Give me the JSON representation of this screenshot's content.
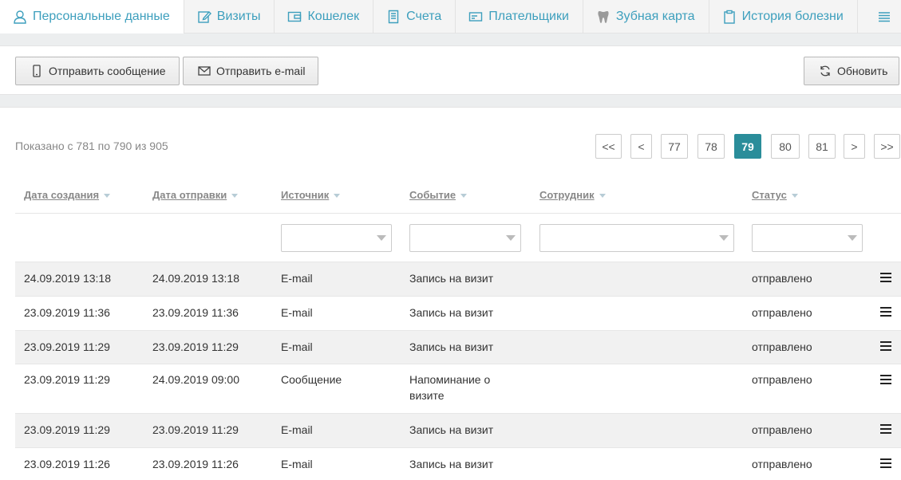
{
  "tabs": [
    {
      "label": "Персональные данные",
      "icon": "person-icon",
      "active": true
    },
    {
      "label": "Визиты",
      "icon": "edit-icon"
    },
    {
      "label": "Кошелек",
      "icon": "wallet-icon"
    },
    {
      "label": "Счета",
      "icon": "receipt-icon"
    },
    {
      "label": "Плательщики",
      "icon": "card-icon"
    },
    {
      "label": "Зубная карта",
      "icon": "tooth-icon"
    },
    {
      "label": "История болезни",
      "icon": "clipboard-icon"
    }
  ],
  "toolbar": {
    "send_message": "Отправить сообщение",
    "send_email": "Отправить e-mail",
    "refresh": "Обновить"
  },
  "summary": "Показано с 781 по 790 из 905",
  "pagination": {
    "first": "<<",
    "prev": "<",
    "pages": [
      "77",
      "78",
      "79",
      "80",
      "81"
    ],
    "current": "79",
    "next": ">",
    "last": ">>"
  },
  "columns": {
    "created": "Дата создания",
    "sent": "Дата отправки",
    "source": "Источник",
    "event": "Событие",
    "employee": "Сотрудник",
    "status": "Статус"
  },
  "rows": [
    {
      "created": "24.09.2019 13:18",
      "sent": "24.09.2019 13:18",
      "source": "E-mail",
      "event": "Запись на визит",
      "employee": "",
      "status": "отправлено"
    },
    {
      "created": "23.09.2019 11:36",
      "sent": "23.09.2019 11:36",
      "source": "E-mail",
      "event": "Запись на визит",
      "employee": "",
      "status": "отправлено"
    },
    {
      "created": "23.09.2019 11:29",
      "sent": "23.09.2019 11:29",
      "source": "E-mail",
      "event": "Запись на визит",
      "employee": "",
      "status": "отправлено"
    },
    {
      "created": "23.09.2019 11:29",
      "sent": "24.09.2019 09:00",
      "source": "Сообщение",
      "event": "Напоминание о визите",
      "employee": "",
      "status": "отправлено"
    },
    {
      "created": "23.09.2019 11:29",
      "sent": "23.09.2019 11:29",
      "source": "E-mail",
      "event": "Запись на визит",
      "employee": "",
      "status": "отправлено"
    },
    {
      "created": "23.09.2019 11:26",
      "sent": "23.09.2019 11:26",
      "source": "E-mail",
      "event": "Запись на визит",
      "employee": "",
      "status": "отправлено"
    }
  ],
  "colors": {
    "accent": "#3d9fbd",
    "active_page": "#2a8d9a",
    "row_alt": "#f1f1f1"
  }
}
